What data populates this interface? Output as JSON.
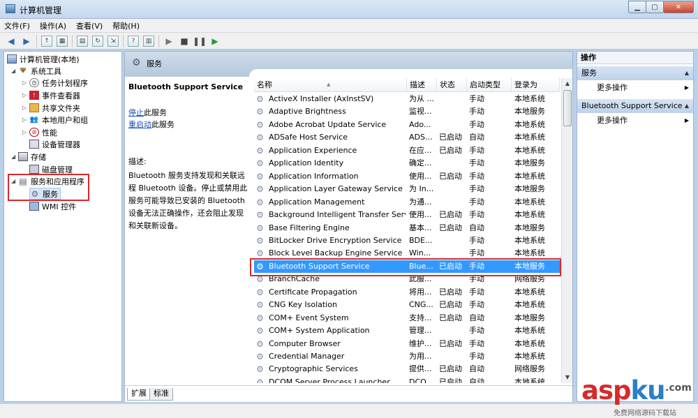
{
  "window": {
    "title": "计算机管理"
  },
  "menu": [
    "文件(F)",
    "操作(A)",
    "查看(V)",
    "帮助(H)"
  ],
  "tree": {
    "root": "计算机管理(本地)",
    "system_tools": "系统工具",
    "task_scheduler": "任务计划程序",
    "event_viewer": "事件查看器",
    "shared_folders": "共享文件夹",
    "local_users": "本地用户和组",
    "performance": "性能",
    "device_manager": "设备管理器",
    "storage": "存储",
    "disk_management": "磁盘管理",
    "services_apps": "服务和应用程序",
    "services": "服务",
    "wmi": "WMI 控件"
  },
  "header": {
    "title": "服务"
  },
  "detail": {
    "service_name": "Bluetooth Support Service",
    "stop_link": "停止",
    "stop_suffix": "此服务",
    "restart_link": "重启动",
    "restart_suffix": "此服务",
    "desc_label": "描述:",
    "desc_text": "Bluetooth 服务支持发现和关联远程 Bluetooth 设备。停止或禁用此服务可能导致已安装的 Bluetooth 设备无法正确操作，还会阻止发现和关联新设备。"
  },
  "columns": {
    "name": "名称",
    "desc": "描述",
    "status": "状态",
    "startup": "启动类型",
    "logon": "登录为"
  },
  "services": [
    {
      "name": "ActiveX Installer (AxInstSV)",
      "desc": "为从 ...",
      "status": "",
      "startup": "手动",
      "logon": "本地系统"
    },
    {
      "name": "Adaptive Brightness",
      "desc": "监视...",
      "status": "",
      "startup": "手动",
      "logon": "本地服务"
    },
    {
      "name": "Adobe Acrobat Update Service",
      "desc": "Ado...",
      "status": "",
      "startup": "手动",
      "logon": "本地系统"
    },
    {
      "name": "ADSafe Host Service",
      "desc": "ADS...",
      "status": "已启动",
      "startup": "自动",
      "logon": "本地系统"
    },
    {
      "name": "Application Experience",
      "desc": "在应...",
      "status": "已启动",
      "startup": "手动",
      "logon": "本地系统"
    },
    {
      "name": "Application Identity",
      "desc": "确定...",
      "status": "",
      "startup": "手动",
      "logon": "本地服务"
    },
    {
      "name": "Application Information",
      "desc": "使用...",
      "status": "已启动",
      "startup": "手动",
      "logon": "本地系统"
    },
    {
      "name": "Application Layer Gateway Service",
      "desc": "为 In...",
      "status": "",
      "startup": "手动",
      "logon": "本地服务"
    },
    {
      "name": "Application Management",
      "desc": "为通...",
      "status": "",
      "startup": "手动",
      "logon": "本地系统"
    },
    {
      "name": "Background Intelligent Transfer Serv...",
      "desc": "使用...",
      "status": "已启动",
      "startup": "手动",
      "logon": "本地系统"
    },
    {
      "name": "Base Filtering Engine",
      "desc": "基本...",
      "status": "已启动",
      "startup": "自动",
      "logon": "本地服务"
    },
    {
      "name": "BitLocker Drive Encryption Service",
      "desc": "BDE...",
      "status": "",
      "startup": "手动",
      "logon": "本地系统"
    },
    {
      "name": "Block Level Backup Engine Service",
      "desc": "Win...",
      "status": "",
      "startup": "手动",
      "logon": "本地系统"
    },
    {
      "name": "Bluetooth Support Service",
      "desc": "Blue...",
      "status": "已启动",
      "startup": "手动",
      "logon": "本地服务",
      "selected": true
    },
    {
      "name": "BranchCache",
      "desc": "此服...",
      "status": "",
      "startup": "手动",
      "logon": "网络服务"
    },
    {
      "name": "Certificate Propagation",
      "desc": "将用...",
      "status": "已启动",
      "startup": "手动",
      "logon": "本地系统"
    },
    {
      "name": "CNG Key Isolation",
      "desc": "CNG...",
      "status": "已启动",
      "startup": "手动",
      "logon": "本地系统"
    },
    {
      "name": "COM+ Event System",
      "desc": "支持...",
      "status": "已启动",
      "startup": "自动",
      "logon": "本地服务"
    },
    {
      "name": "COM+ System Application",
      "desc": "管理...",
      "status": "",
      "startup": "手动",
      "logon": "本地系统"
    },
    {
      "name": "Computer Browser",
      "desc": "维护...",
      "status": "已启动",
      "startup": "手动",
      "logon": "本地系统"
    },
    {
      "name": "Credential Manager",
      "desc": "为用...",
      "status": "",
      "startup": "手动",
      "logon": "本地系统"
    },
    {
      "name": "Cryptographic Services",
      "desc": "提供...",
      "status": "已启动",
      "startup": "自动",
      "logon": "网络服务"
    },
    {
      "name": "DCOM Server Process Launcher",
      "desc": "DCO...",
      "status": "已启动",
      "startup": "自动",
      "logon": "本地系统"
    }
  ],
  "tabs": {
    "extended": "扩展",
    "standard": "标准"
  },
  "actions": {
    "title": "操作",
    "section1": "服务",
    "more1": "更多操作",
    "section2": "Bluetooth Support Service",
    "more2": "更多操作"
  },
  "watermark": {
    "main_a": "asp",
    "main_k": "ku",
    "domain": ".com",
    "sub": "免费网络源码下载站"
  }
}
